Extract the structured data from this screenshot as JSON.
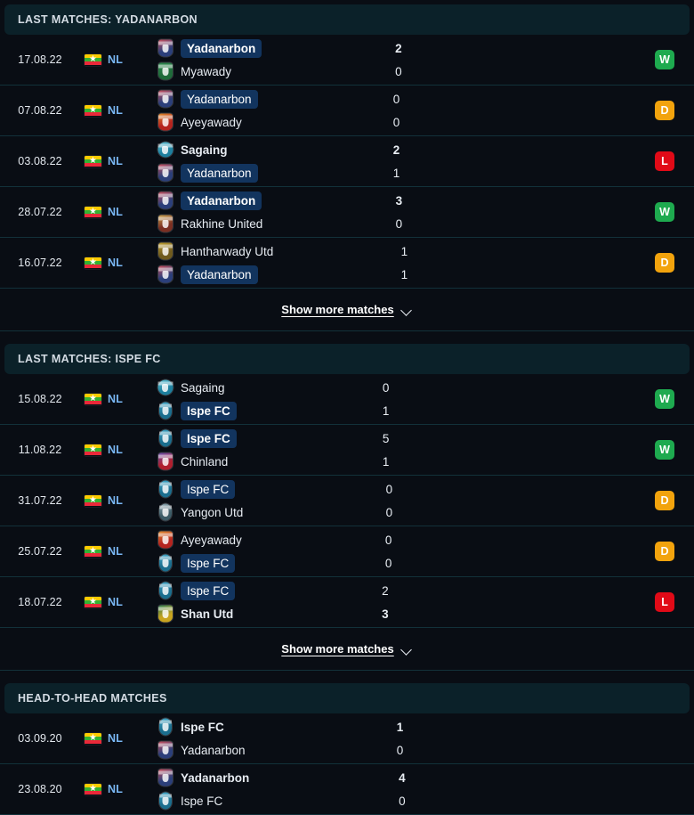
{
  "theme": {
    "page_bg": "#090d14",
    "header_bg": "#0b2129",
    "highlight_bg": "#12345e",
    "separator": "#12313a",
    "league_color": "#7ab8f5",
    "win_color": "#1eaa4f",
    "draw_color": "#f2a30d",
    "loss_color": "#e10a17"
  },
  "flag": {
    "name": "myanmar-flag",
    "star": "★"
  },
  "sections": [
    {
      "id": "last-matches-yadanarbon",
      "title": "LAST MATCHES: YADANARBON",
      "show_more_label": "Show more matches",
      "has_show_more": true,
      "matches": [
        {
          "date": "17.08.22",
          "league": "NL",
          "home": {
            "name": "Yadanarbon",
            "highlight": true,
            "bold": true,
            "logo": "shield",
            "c1": "#2b3f7a",
            "c2": "#c94f5e"
          },
          "away": {
            "name": "Myawady",
            "highlight": false,
            "bold": false,
            "logo": "shield",
            "c1": "#1f6b3a",
            "c2": "#2e8b4f"
          },
          "home_score": "2",
          "away_score": "0",
          "home_bold": true,
          "away_bold": false,
          "result": "W"
        },
        {
          "date": "07.08.22",
          "league": "NL",
          "home": {
            "name": "Yadanarbon",
            "highlight": true,
            "bold": false,
            "logo": "shield",
            "c1": "#2b3f7a",
            "c2": "#c94f5e"
          },
          "away": {
            "name": "Ayeyawady",
            "highlight": false,
            "bold": false,
            "logo": "shield",
            "c1": "#b5241f",
            "c2": "#e0892a"
          },
          "home_score": "0",
          "away_score": "0",
          "home_bold": false,
          "away_bold": false,
          "result": "D"
        },
        {
          "date": "03.08.22",
          "league": "NL",
          "home": {
            "name": "Sagaing",
            "highlight": false,
            "bold": true,
            "logo": "round",
            "c1": "#1d7f9e",
            "c2": "#63c6d8"
          },
          "away": {
            "name": "Yadanarbon",
            "highlight": true,
            "bold": false,
            "logo": "shield",
            "c1": "#2b3f7a",
            "c2": "#c94f5e"
          },
          "home_score": "2",
          "away_score": "1",
          "home_bold": true,
          "away_bold": false,
          "result": "L"
        },
        {
          "date": "28.07.22",
          "league": "NL",
          "home": {
            "name": "Yadanarbon",
            "highlight": true,
            "bold": true,
            "logo": "shield",
            "c1": "#2b3f7a",
            "c2": "#c94f5e"
          },
          "away": {
            "name": "Rakhine United",
            "highlight": false,
            "bold": false,
            "logo": "shield",
            "c1": "#7b2f22",
            "c2": "#c9a14a"
          },
          "home_score": "3",
          "away_score": "0",
          "home_bold": true,
          "away_bold": false,
          "result": "W"
        },
        {
          "date": "16.07.22",
          "league": "NL",
          "home": {
            "name": "Hantharwady Utd",
            "highlight": false,
            "bold": false,
            "logo": "shield",
            "c1": "#6f5a1e",
            "c2": "#c0a030"
          },
          "away": {
            "name": "Yadanarbon",
            "highlight": true,
            "bold": false,
            "logo": "shield",
            "c1": "#2b3f7a",
            "c2": "#c94f5e"
          },
          "home_score": "1",
          "away_score": "1",
          "home_bold": false,
          "away_bold": false,
          "result": "D"
        }
      ]
    },
    {
      "id": "last-matches-ispe-fc",
      "title": "LAST MATCHES: ISPE FC",
      "show_more_label": "Show more matches",
      "has_show_more": true,
      "matches": [
        {
          "date": "15.08.22",
          "league": "NL",
          "home": {
            "name": "Sagaing",
            "highlight": false,
            "bold": false,
            "logo": "round",
            "c1": "#1d7f9e",
            "c2": "#63c6d8"
          },
          "away": {
            "name": "Ispe FC",
            "highlight": true,
            "bold": true,
            "logo": "oval",
            "c1": "#1b6e8e",
            "c2": "#3fa8c9"
          },
          "home_score": "0",
          "away_score": "1",
          "home_bold": false,
          "away_bold": false,
          "result": "W"
        },
        {
          "date": "11.08.22",
          "league": "NL",
          "home": {
            "name": "Ispe FC",
            "highlight": true,
            "bold": true,
            "logo": "oval",
            "c1": "#1b6e8e",
            "c2": "#3fa8c9"
          },
          "away": {
            "name": "Chinland",
            "highlight": false,
            "bold": false,
            "logo": "shield",
            "c1": "#b01f2e",
            "c2": "#6a4fb0"
          },
          "home_score": "5",
          "away_score": "1",
          "home_bold": false,
          "away_bold": false,
          "result": "W"
        },
        {
          "date": "31.07.22",
          "league": "NL",
          "home": {
            "name": "Ispe FC",
            "highlight": true,
            "bold": false,
            "logo": "oval",
            "c1": "#1b6e8e",
            "c2": "#3fa8c9"
          },
          "away": {
            "name": "Yangon Utd",
            "highlight": false,
            "bold": false,
            "logo": "oval",
            "c1": "#3c5b66",
            "c2": "#8fa9b3"
          },
          "home_score": "0",
          "away_score": "0",
          "home_bold": false,
          "away_bold": false,
          "result": "D"
        },
        {
          "date": "25.07.22",
          "league": "NL",
          "home": {
            "name": "Ayeyawady",
            "highlight": false,
            "bold": false,
            "logo": "shield",
            "c1": "#b5241f",
            "c2": "#e0892a"
          },
          "away": {
            "name": "Ispe FC",
            "highlight": true,
            "bold": false,
            "logo": "oval",
            "c1": "#1b6e8e",
            "c2": "#3fa8c9"
          },
          "home_score": "0",
          "away_score": "0",
          "home_bold": false,
          "away_bold": false,
          "result": "D"
        },
        {
          "date": "18.07.22",
          "league": "NL",
          "home": {
            "name": "Ispe FC",
            "highlight": true,
            "bold": false,
            "logo": "oval",
            "c1": "#1b6e8e",
            "c2": "#3fa8c9"
          },
          "away": {
            "name": "Shan Utd",
            "highlight": false,
            "bold": true,
            "logo": "shield",
            "c1": "#c9a41f",
            "c2": "#2e7d4f"
          },
          "home_score": "2",
          "away_score": "3",
          "home_bold": false,
          "away_bold": true,
          "result": "L"
        }
      ]
    },
    {
      "id": "head-to-head-matches",
      "title": "HEAD-TO-HEAD MATCHES",
      "show_more_label": "",
      "has_show_more": false,
      "matches": [
        {
          "date": "03.09.20",
          "league": "NL",
          "home": {
            "name": "Ispe FC",
            "highlight": false,
            "bold": true,
            "logo": "oval",
            "c1": "#1b6e8e",
            "c2": "#3fa8c9"
          },
          "away": {
            "name": "Yadanarbon",
            "highlight": false,
            "bold": false,
            "logo": "shield",
            "c1": "#2b3f7a",
            "c2": "#c94f5e"
          },
          "home_score": "1",
          "away_score": "0",
          "home_bold": true,
          "away_bold": false,
          "result": ""
        },
        {
          "date": "23.08.20",
          "league": "NL",
          "home": {
            "name": "Yadanarbon",
            "highlight": false,
            "bold": true,
            "logo": "shield",
            "c1": "#2b3f7a",
            "c2": "#c94f5e"
          },
          "away": {
            "name": "Ispe FC",
            "highlight": false,
            "bold": false,
            "logo": "oval",
            "c1": "#1b6e8e",
            "c2": "#3fa8c9"
          },
          "home_score": "4",
          "away_score": "0",
          "home_bold": true,
          "away_bold": false,
          "result": ""
        }
      ]
    }
  ]
}
